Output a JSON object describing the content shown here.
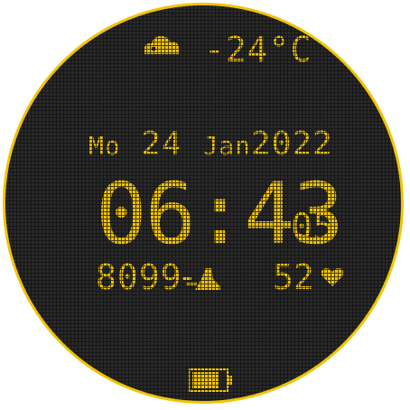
{
  "weather": {
    "icon": "cloud-icon",
    "temperature": "-24°C"
  },
  "date": {
    "day_of_week": "Mo",
    "day": "24",
    "month": "Jan",
    "year": "2022"
  },
  "time": {
    "hours_minutes": "06:43",
    "seconds": "05"
  },
  "stats": {
    "steps": "8099",
    "steps_icon": "footsteps-icon",
    "heart_rate": "52",
    "heart_icon": "heart-icon"
  },
  "battery": {
    "icon": "battery-icon",
    "level_fraction": 0.8
  },
  "colors": {
    "accent": "#f2c400",
    "background": "#2a2a2a"
  }
}
